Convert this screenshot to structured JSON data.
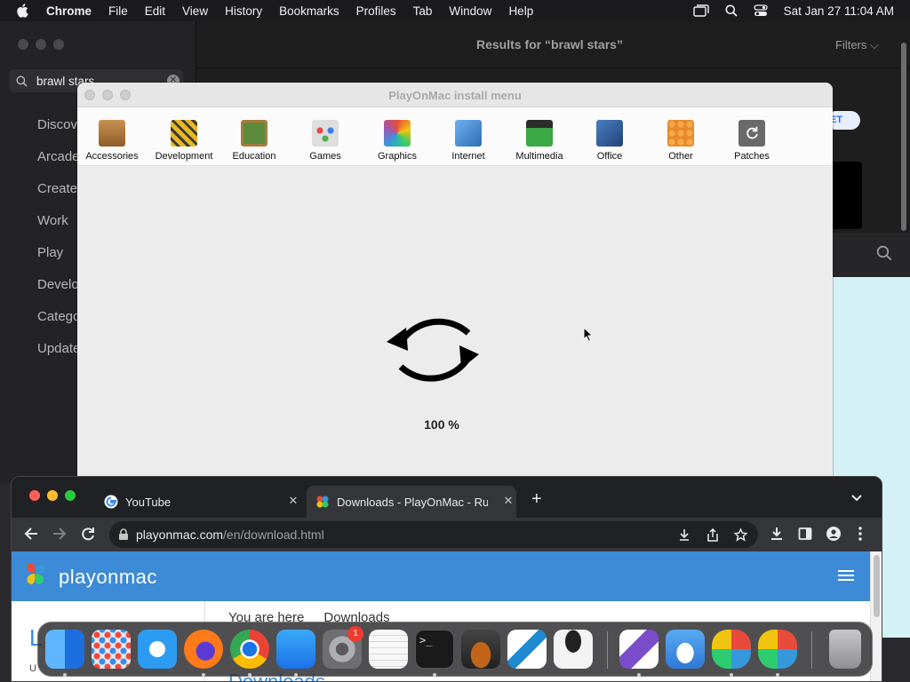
{
  "menubar": {
    "app_name": "Chrome",
    "items": [
      "File",
      "Edit",
      "View",
      "History",
      "Bookmarks",
      "Profiles",
      "Tab",
      "Window",
      "Help"
    ],
    "clock": "Sat Jan 27  11:04 AM"
  },
  "appstore": {
    "search_value": "brawl stars",
    "nav_items": [
      "Discov",
      "Arcade",
      "Create",
      "Work",
      "Play",
      "Develo",
      "Catego",
      "Update"
    ],
    "results_title": "Results for “brawl stars”",
    "filters_label": "Filters",
    "get_label": "ET"
  },
  "playonmac": {
    "title": "PlayOnMac install menu",
    "categories": [
      {
        "label": "Accessories",
        "icon": "calculator-icon",
        "color": "#b07a3a"
      },
      {
        "label": "Development",
        "icon": "construction-icon",
        "color": "#d9a521"
      },
      {
        "label": "Education",
        "icon": "chalkboard-icon",
        "color": "#5b8a3a"
      },
      {
        "label": "Games",
        "icon": "gamepad-icon",
        "color": "#cfcfcf"
      },
      {
        "label": "Graphics",
        "icon": "color-wheel-icon",
        "color": "#e05a9a"
      },
      {
        "label": "Internet",
        "icon": "globe-icon",
        "color": "#4a90d9"
      },
      {
        "label": "Multimedia",
        "icon": "clapper-icon",
        "color": "#2c2c2c"
      },
      {
        "label": "Office",
        "icon": "chart-icon",
        "color": "#2f5f9e"
      },
      {
        "label": "Other",
        "icon": "other-icon",
        "color": "#e88a2c"
      },
      {
        "label": "Patches",
        "icon": "refresh-icon",
        "color": "#6a6a6a"
      }
    ],
    "progress_text": "100 %"
  },
  "chrome": {
    "tabs": [
      {
        "title": "YouTube",
        "active": false
      },
      {
        "title": "Downloads - PlayOnMac - Run",
        "active": true
      }
    ],
    "url_host": "playonmac.com",
    "url_path": "/en/download.html",
    "site_brand": "playonmac",
    "breadcrumb_label": "You are here",
    "breadcrumb_current": "Downloads",
    "left_heading_fragment": "L",
    "left_small_fragment": "U",
    "main_heading": "Downloads"
  },
  "dock": {
    "apps": [
      {
        "name": "finder-icon",
        "color": "#2d8df0"
      },
      {
        "name": "launchpad-icon",
        "color": "#e9e9ee"
      },
      {
        "name": "safari-icon",
        "color": "#2b9cf2"
      },
      {
        "name": "firefox-icon",
        "color": "#ff7a1a"
      },
      {
        "name": "chrome-icon",
        "color": "#ffffff"
      },
      {
        "name": "app-store-icon",
        "color": "#1e8ff5"
      },
      {
        "name": "system-settings-icon",
        "color": "#8e8e93"
      },
      {
        "name": "textedit-icon",
        "color": "#f7f7f7"
      },
      {
        "name": "terminal-icon",
        "color": "#1a1a1a"
      },
      {
        "name": "garageband-icon",
        "color": "#f08a24"
      },
      {
        "name": "vscode-icon",
        "color": "#ffffff"
      },
      {
        "name": "bartender-icon",
        "color": "#f3f3f3"
      },
      {
        "name": "visual-studio-icon",
        "color": "#ffffff"
      },
      {
        "name": "weather-icon",
        "color": "#3a8ee6"
      },
      {
        "name": "playonmac-icon",
        "color": "#3aa845"
      },
      {
        "name": "playonmac-2-icon",
        "color": "#3aa845"
      },
      {
        "name": "trash-icon",
        "color": "#9a9a9e"
      }
    ],
    "settings_badge": "1"
  }
}
